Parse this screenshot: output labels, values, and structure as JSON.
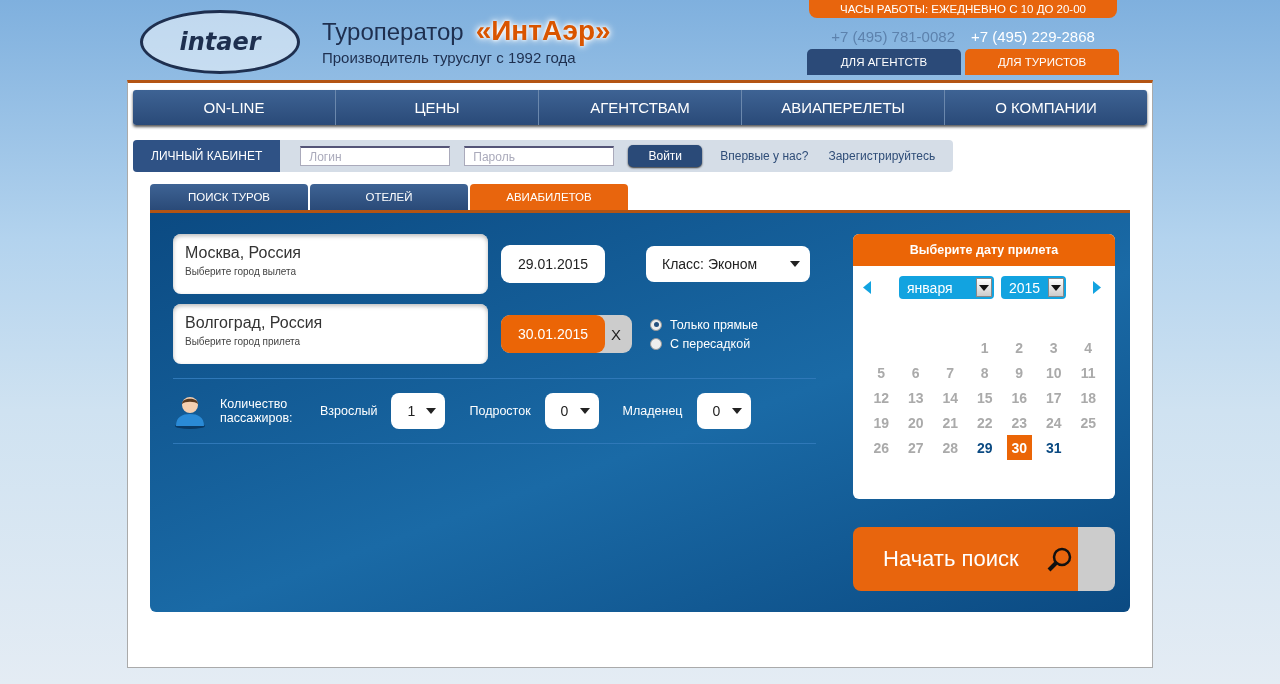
{
  "header": {
    "logo": "intaer",
    "title": "Туроператор",
    "brand": "«ИнтАэр»",
    "subtitle": "Производитель туруслуг с 1992 года",
    "hours": "ЧАСЫ РАБОТЫ: ЕЖЕДНЕВНО С 10 ДО 20-00",
    "phones": [
      "+7 (495) 781-0082",
      "+7 (495) 229-2868"
    ],
    "audience_tabs": [
      {
        "label": "ДЛЯ АГЕНТСТВ",
        "selected": false
      },
      {
        "label": "ДЛЯ ТУРИСТОВ",
        "selected": true
      }
    ]
  },
  "nav": [
    "ON-LINE",
    "ЦЕНЫ",
    "АГЕНТСТВАМ",
    "АВИАПЕРЕЛЕТЫ",
    "О КОМПАНИИ"
  ],
  "login": {
    "label": "ЛИЧНЫЙ КАБИНЕТ",
    "login_placeholder": "Логин",
    "password_placeholder": "Пароль",
    "button": "Войти",
    "first_time": "Впервые у нас?",
    "register": "Зарегистрируйтесь"
  },
  "search_tabs": [
    {
      "label": "ПОИСК ТУРОВ",
      "selected": false
    },
    {
      "label": "ОТЕЛЕЙ",
      "selected": false
    },
    {
      "label": "АВИАБИЛЕТОВ",
      "selected": true
    }
  ],
  "form": {
    "from": {
      "value": "Москва, Россия",
      "hint": "Выберите город вылета"
    },
    "to": {
      "value": "Волгоград, Россия",
      "hint": "Выберите город прилета"
    },
    "depart_date": {
      "value": "29.01.2015",
      "selected": false
    },
    "return_date": {
      "value": "30.01.2015",
      "selected": true,
      "clear": "X"
    },
    "class_select": "Класс: Эконом",
    "route_options": [
      {
        "label": "Только прямые",
        "selected": true
      },
      {
        "label": "С пересадкой",
        "selected": false
      }
    ],
    "passengers_label": "Количество пассажиров:",
    "passengers": [
      {
        "label": "Взрослый",
        "value": "1"
      },
      {
        "label": "Подросток",
        "value": "0"
      },
      {
        "label": "Младенец",
        "value": "0"
      }
    ],
    "search_button": "Начать поиск"
  },
  "calendar": {
    "title": "Выберите дату прилета",
    "month": "января",
    "year": "2015",
    "weeks": [
      [
        {
          "day": "1",
          "disabled": true,
          "selected": false
        },
        {
          "day": "2",
          "disabled": true,
          "selected": false
        },
        {
          "day": "3",
          "disabled": true,
          "selected": false
        },
        {
          "day": "4",
          "disabled": true,
          "selected": false
        }
      ],
      [
        {
          "day": "5",
          "disabled": true,
          "selected": false
        },
        {
          "day": "6",
          "disabled": true,
          "selected": false
        },
        {
          "day": "7",
          "disabled": true,
          "selected": false
        },
        {
          "day": "8",
          "disabled": true,
          "selected": false
        },
        {
          "day": "9",
          "disabled": true,
          "selected": false
        },
        {
          "day": "10",
          "disabled": true,
          "selected": false
        },
        {
          "day": "11",
          "disabled": true,
          "selected": false
        }
      ],
      [
        {
          "day": "12",
          "disabled": true,
          "selected": false
        },
        {
          "day": "13",
          "disabled": true,
          "selected": false
        },
        {
          "day": "14",
          "disabled": true,
          "selected": false
        },
        {
          "day": "15",
          "disabled": true,
          "selected": false
        },
        {
          "day": "16",
          "disabled": true,
          "selected": false
        },
        {
          "day": "17",
          "disabled": true,
          "selected": false
        },
        {
          "day": "18",
          "disabled": true,
          "selected": false
        }
      ],
      [
        {
          "day": "19",
          "disabled": true,
          "selected": false
        },
        {
          "day": "20",
          "disabled": true,
          "selected": false
        },
        {
          "day": "21",
          "disabled": true,
          "selected": false
        },
        {
          "day": "22",
          "disabled": true,
          "selected": false
        },
        {
          "day": "23",
          "disabled": true,
          "selected": false
        },
        {
          "day": "24",
          "disabled": true,
          "selected": false
        },
        {
          "day": "25",
          "disabled": true,
          "selected": false
        }
      ],
      [
        {
          "day": "26",
          "disabled": true,
          "selected": false
        },
        {
          "day": "27",
          "disabled": true,
          "selected": false
        },
        {
          "day": "28",
          "disabled": true,
          "selected": false
        },
        {
          "day": "29",
          "disabled": false,
          "selected": false
        },
        {
          "day": "30",
          "disabled": false,
          "selected": true
        },
        {
          "day": "31",
          "disabled": false,
          "selected": false
        }
      ]
    ]
  }
}
